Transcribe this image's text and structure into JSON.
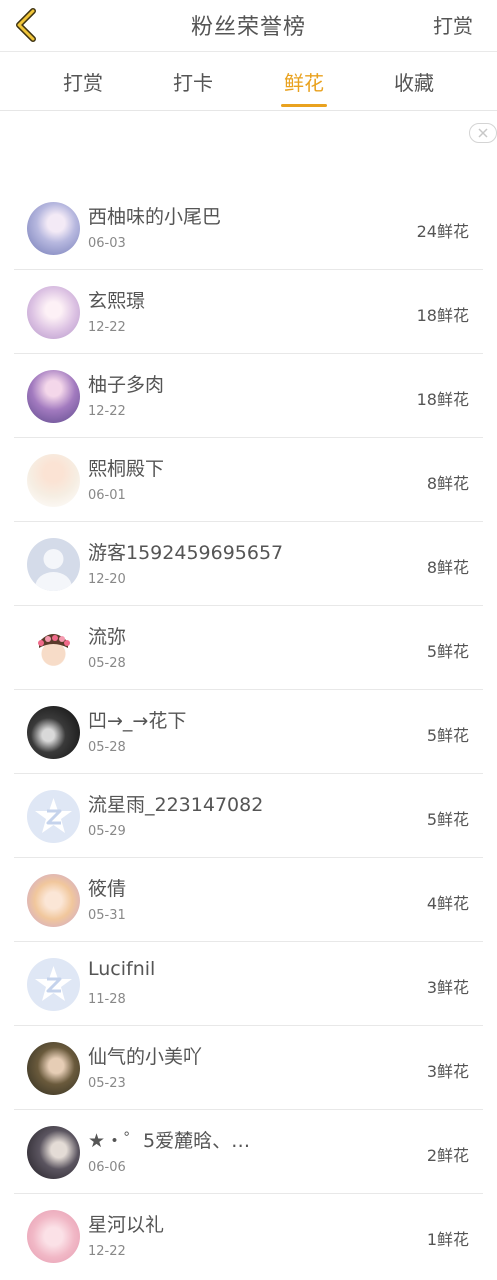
{
  "header": {
    "title": "粉丝荣誉榜",
    "action_label": "打赏",
    "back_icon": "chevron-left-icon",
    "accent_color": "#e9a21f"
  },
  "tabs": [
    {
      "label": "打赏",
      "active": false
    },
    {
      "label": "打卡",
      "active": false
    },
    {
      "label": "鲜花",
      "active": true
    },
    {
      "label": "收藏",
      "active": false
    }
  ],
  "ad": {
    "close_icon": "close-icon"
  },
  "unit": "鲜花",
  "fans": [
    {
      "name": "西柚味的小尾巴",
      "date": "06-03",
      "count": "24鲜花"
    },
    {
      "name": "玄熙璟",
      "date": "12-22",
      "count": "18鲜花"
    },
    {
      "name": "柚子多肉",
      "date": "12-22",
      "count": "18鲜花"
    },
    {
      "name": "熙桐殿下",
      "date": "06-01",
      "count": "8鲜花"
    },
    {
      "name": "游客1592459695657",
      "date": "12-20",
      "count": "8鲜花"
    },
    {
      "name": "流弥",
      "date": "05-28",
      "count": "5鲜花"
    },
    {
      "name": "凹→_→花下",
      "date": "05-28",
      "count": "5鲜花"
    },
    {
      "name": "流星雨_223147082",
      "date": "05-29",
      "count": "5鲜花"
    },
    {
      "name": "筱倩",
      "date": "05-31",
      "count": "4鲜花"
    },
    {
      "name": "Lucifnil",
      "date": "11-28",
      "count": "3鲜花"
    },
    {
      "name": "仙气的小美吖",
      "date": "05-23",
      "count": "3鲜花"
    },
    {
      "name": "★・゜5爱麓晗、…",
      "date": "06-06",
      "count": "2鲜花"
    },
    {
      "name": "星河以礼",
      "date": "12-22",
      "count": "1鲜花"
    }
  ]
}
